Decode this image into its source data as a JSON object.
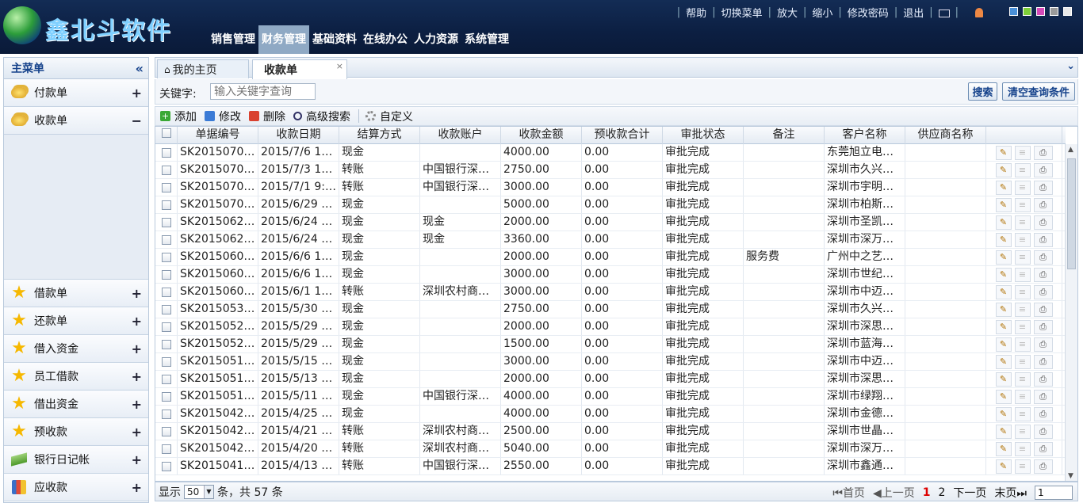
{
  "header": {
    "logo_text": "鑫北斗软件",
    "top_links": [
      "帮助",
      "切换菜单",
      "放大",
      "缩小",
      "修改密码",
      "退出"
    ],
    "skin_colors": [
      "#4a90d9",
      "#7fcf3a",
      "#d64ab8",
      "#9a9a9a",
      "#e8e8e8"
    ],
    "nav": [
      "销售管理",
      "财务管理",
      "基础资料",
      "在线办公",
      "人力资源",
      "系统管理"
    ],
    "active_nav": "财务管理"
  },
  "sidebar": {
    "title": "主菜单",
    "collapse_glyph": "«",
    "items_top": [
      {
        "label": "付款单",
        "toggle": "+",
        "icon": "coins-icon"
      },
      {
        "label": "收款单",
        "toggle": "−",
        "icon": "coins-icon"
      }
    ],
    "items_bottom": [
      {
        "label": "借款单",
        "toggle": "+",
        "icon": "star-icon"
      },
      {
        "label": "还款单",
        "toggle": "+",
        "icon": "star-icon"
      },
      {
        "label": "借入资金",
        "toggle": "+",
        "icon": "star-icon"
      },
      {
        "label": "员工借款",
        "toggle": "+",
        "icon": "star-icon"
      },
      {
        "label": "借出资金",
        "toggle": "+",
        "icon": "star-icon"
      },
      {
        "label": "预收款",
        "toggle": "+",
        "icon": "star-icon"
      },
      {
        "label": "银行日记帐",
        "toggle": "+",
        "icon": "money-icon"
      },
      {
        "label": "应收款",
        "toggle": "+",
        "icon": "chart-icon"
      }
    ]
  },
  "tabs": [
    {
      "label": "我的主页",
      "icon": "home-icon"
    },
    {
      "label": "收款单",
      "close": "×"
    }
  ],
  "search": {
    "label": "关键字:",
    "placeholder": "输入关键字查询",
    "search_button": "搜索",
    "clear_button": "清空查询条件"
  },
  "toolbar": {
    "add": "添加",
    "edit": "修改",
    "delete": "删除",
    "advanced_search": "高级搜索",
    "customize": "自定义"
  },
  "table": {
    "columns": [
      "单据编号",
      "收款日期",
      "结算方式",
      "收款账户",
      "收款金额",
      "预收款合计",
      "审批状态",
      "备注",
      "客户名称",
      "供应商名称"
    ],
    "rows": [
      [
        "SK2015070…",
        "2015/7/6 15:…",
        "现金",
        "",
        "4000.00",
        "0.00",
        "审批完成",
        "",
        "东莞旭立电…",
        ""
      ],
      [
        "SK2015070…",
        "2015/7/3 17:…",
        "转账",
        "中国银行深…",
        "2750.00",
        "0.00",
        "审批完成",
        "",
        "深圳市久兴…",
        ""
      ],
      [
        "SK2015070…",
        "2015/7/1 9:2…",
        "转账",
        "中国银行深…",
        "3000.00",
        "0.00",
        "审批完成",
        "",
        "深圳市宇明…",
        ""
      ],
      [
        "SK2015070…",
        "2015/6/29 1…",
        "现金",
        "",
        "5000.00",
        "0.00",
        "审批完成",
        "",
        "深圳市柏斯…",
        ""
      ],
      [
        "SK2015062…",
        "2015/6/24 2…",
        "现金",
        "现金",
        "2000.00",
        "0.00",
        "审批完成",
        "",
        "深圳市圣凯…",
        ""
      ],
      [
        "SK2015062…",
        "2015/6/24 2…",
        "现金",
        "现金",
        "3360.00",
        "0.00",
        "审批完成",
        "",
        "深圳市深万…",
        ""
      ],
      [
        "SK2015060…",
        "2015/6/6 14:…",
        "现金",
        "",
        "2000.00",
        "0.00",
        "审批完成",
        "服务费",
        "广州中之艺…",
        ""
      ],
      [
        "SK2015060…",
        "2015/6/6 14:…",
        "现金",
        "",
        "3000.00",
        "0.00",
        "审批完成",
        "",
        "深圳市世纪…",
        ""
      ],
      [
        "SK2015060…",
        "2015/6/1 16:…",
        "转账",
        "深圳农村商…",
        "3000.00",
        "0.00",
        "审批完成",
        "",
        "深圳市中迈…",
        ""
      ],
      [
        "SK2015053…",
        "2015/5/30 9:…",
        "现金",
        "",
        "2750.00",
        "0.00",
        "审批完成",
        "",
        "深圳市久兴…",
        ""
      ],
      [
        "SK2015052…",
        "2015/5/29 1…",
        "现金",
        "",
        "2000.00",
        "0.00",
        "审批完成",
        "",
        "深圳市深思…",
        ""
      ],
      [
        "SK2015052…",
        "2015/5/29 1…",
        "现金",
        "",
        "1500.00",
        "0.00",
        "审批完成",
        "",
        "深圳市蓝海…",
        ""
      ],
      [
        "SK2015051…",
        "2015/5/15 1…",
        "现金",
        "",
        "3000.00",
        "0.00",
        "审批完成",
        "",
        "深圳市中迈…",
        ""
      ],
      [
        "SK2015051…",
        "2015/5/13 2…",
        "现金",
        "",
        "2000.00",
        "0.00",
        "审批完成",
        "",
        "深圳市深思…",
        ""
      ],
      [
        "SK2015051…",
        "2015/5/11 1…",
        "现金",
        "中国银行深…",
        "4000.00",
        "0.00",
        "审批完成",
        "",
        "深圳市绿翔…",
        ""
      ],
      [
        "SK2015042…",
        "2015/4/25 1…",
        "现金",
        "",
        "4000.00",
        "0.00",
        "审批完成",
        "",
        "深圳市金德…",
        ""
      ],
      [
        "SK2015042…",
        "2015/4/21 8:…",
        "转账",
        "深圳农村商…",
        "2500.00",
        "0.00",
        "审批完成",
        "",
        "深圳市世晶…",
        ""
      ],
      [
        "SK2015042…",
        "2015/4/20 8:…",
        "转账",
        "深圳农村商…",
        "5040.00",
        "0.00",
        "审批完成",
        "",
        "深圳市深万…",
        ""
      ],
      [
        "SK2015041…",
        "2015/4/13 1…",
        "转账",
        "中国银行深…",
        "2550.00",
        "0.00",
        "审批完成",
        "",
        "深圳市鑫通…",
        ""
      ]
    ]
  },
  "pager": {
    "show_label": "显示",
    "page_size": "50",
    "total_text": "条，共 57 条",
    "first": "首页",
    "prev": "上一页",
    "pages": [
      "1",
      "2"
    ],
    "current_page": "1",
    "next": "下一页",
    "last": "末页",
    "page_input": "1"
  }
}
